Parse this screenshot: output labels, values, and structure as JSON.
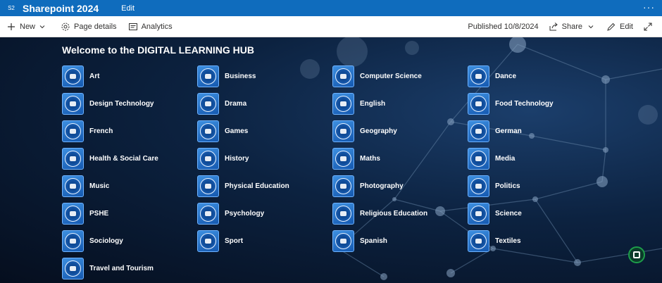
{
  "suitebar": {
    "badge": "S2",
    "site_title": "Sharepoint 2024",
    "edit_label": "Edit",
    "more_label": "···"
  },
  "cmdbar": {
    "new_label": "New",
    "page_details_label": "Page details",
    "analytics_label": "Analytics",
    "published": "Published 10/8/2024",
    "share_label": "Share",
    "edit_label": "Edit"
  },
  "hub": {
    "title": "Welcome to the DIGITAL LEARNING HUB",
    "subjects": [
      "Art",
      "Business",
      "Computer Science",
      "Dance",
      "Design Technology",
      "Drama",
      "English",
      "Food Technology",
      "French",
      "Games",
      "Geography",
      "German",
      "Health & Social Care",
      "History",
      "Maths",
      "Media",
      "Music",
      "Physical Education",
      "Photography",
      "Politics",
      "PSHE",
      "Psychology",
      "Religious Education",
      "Science",
      "Sociology",
      "Sport",
      "Spanish",
      "Textiles",
      "Travel and Tourism"
    ]
  },
  "colors": {
    "suitebar_bg": "#0f6cbd",
    "hero_bg": "#0a1a33",
    "tile_bg": "#1e6bc8"
  }
}
